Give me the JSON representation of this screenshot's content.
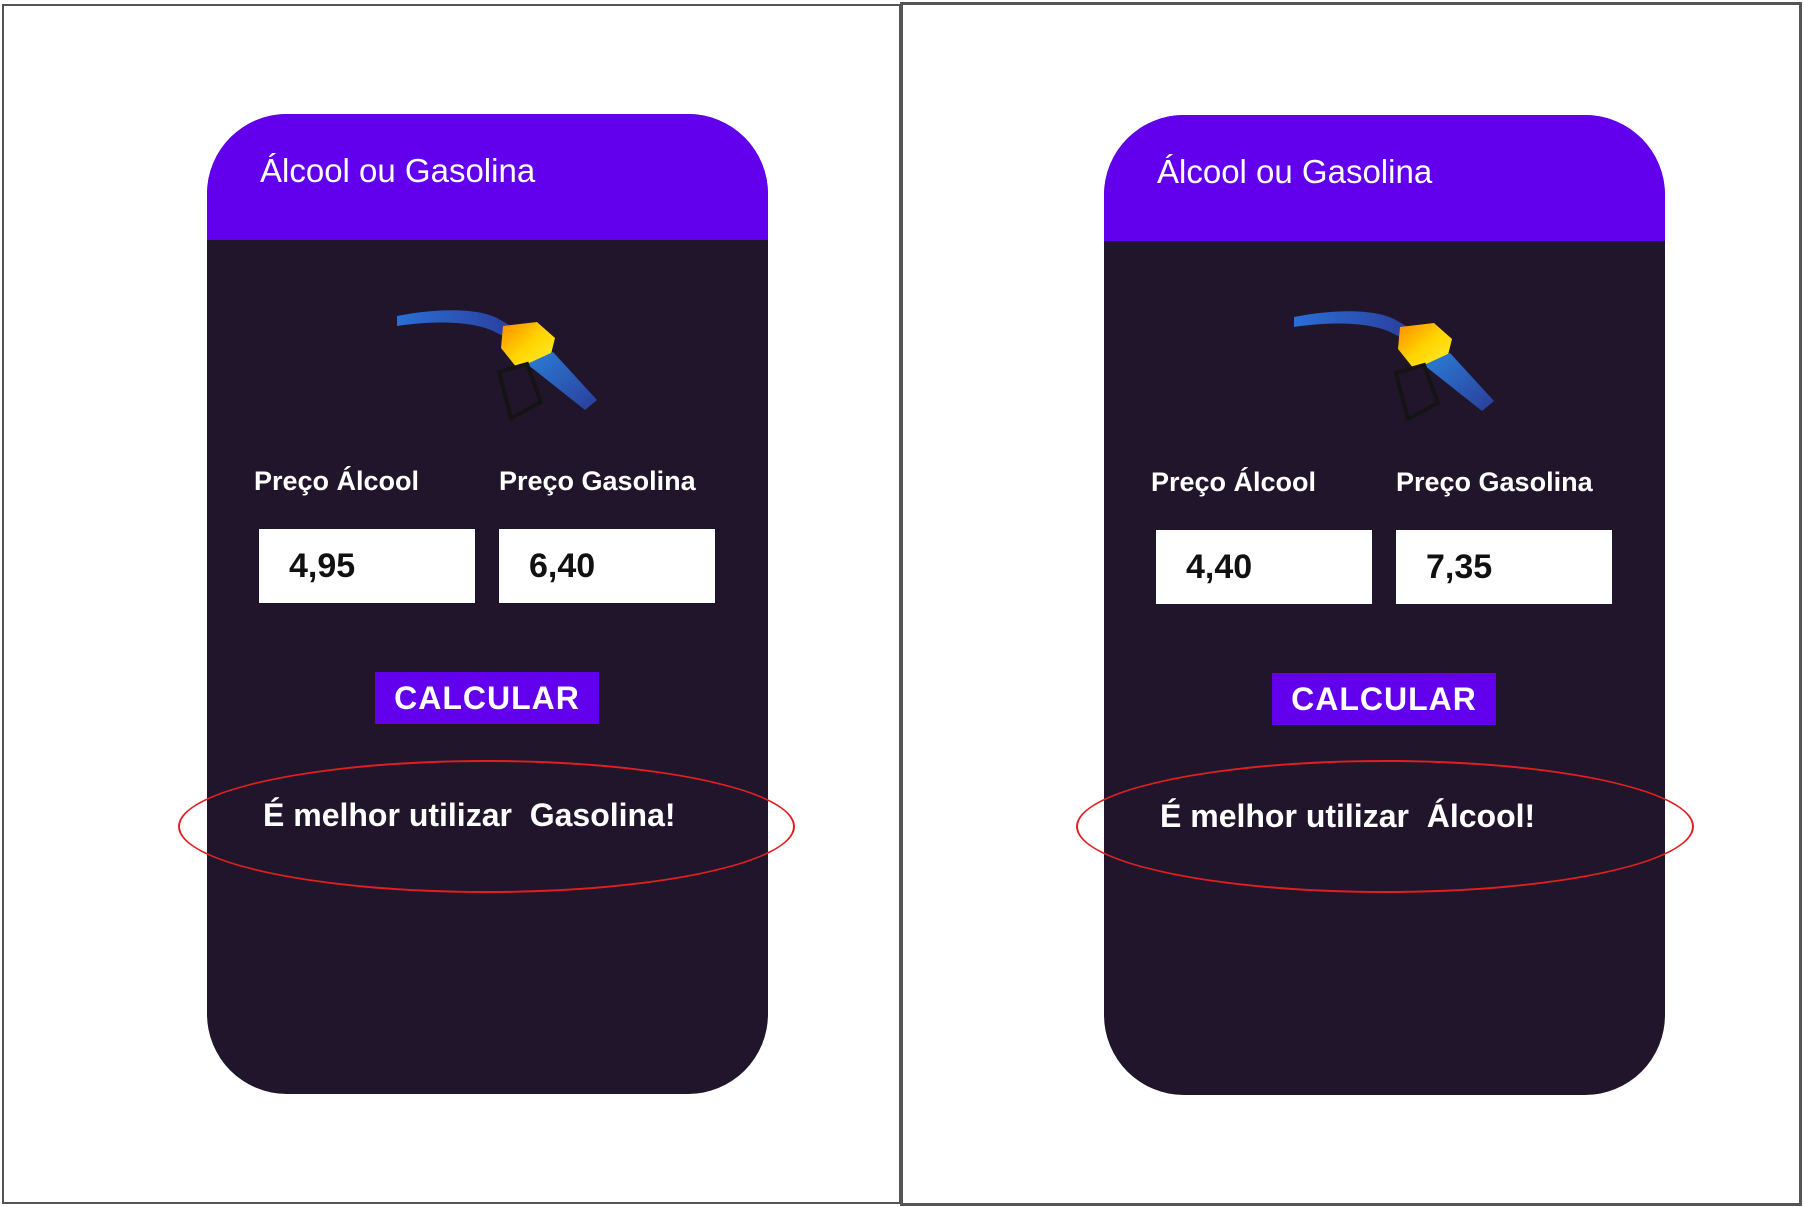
{
  "colors": {
    "header": "#6200ee",
    "card_background": "#21152b",
    "button": "#6200ee",
    "highlight_ellipse": "#e02020",
    "text": "#ffffff"
  },
  "screens": [
    {
      "app_title": "Álcool ou Gasolina",
      "icon": "fuel-pump-nozzle-icon",
      "label_alcool": "Preço Álcool",
      "label_gasolina": "Preço Gasolina",
      "value_alcool": "4,95",
      "value_gasolina": "6,40",
      "button_label": "CALCULAR",
      "result": "É melhor utilizar  Gasolina!"
    },
    {
      "app_title": "Álcool ou Gasolina",
      "icon": "fuel-pump-nozzle-icon",
      "label_alcool": "Preço Álcool",
      "label_gasolina": "Preço Gasolina",
      "value_alcool": "4,40",
      "value_gasolina": "7,35",
      "button_label": "CALCULAR",
      "result": "É melhor utilizar  Álcool!"
    }
  ]
}
